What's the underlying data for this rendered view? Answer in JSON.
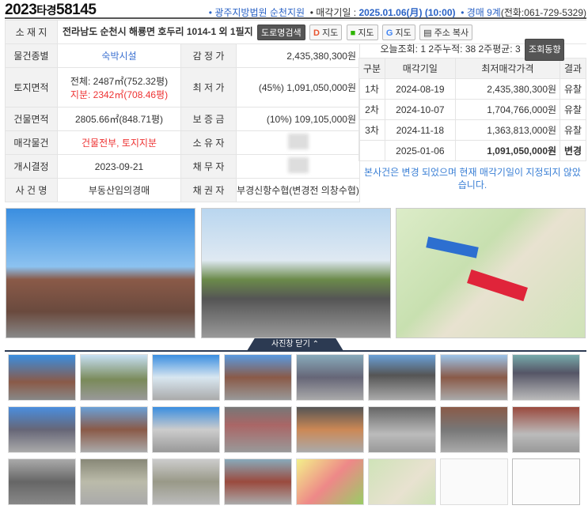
{
  "header": {
    "case_year": "2023",
    "case_type": "타경",
    "case_no": "58145",
    "court": "• 광주지방법원 순천지원",
    "sale_label": "• 매각기일 : ",
    "sale_date": "2025.01.06(月) (10:00)",
    "dept": "• 경매 9계",
    "phone": "(전화:061-729-5329)"
  },
  "address": {
    "label": "소 재 지",
    "value": "전라남도 순천시 해룡면 호두리 1014-1 외 1필지",
    "buttons": [
      "도로명검색",
      "지도",
      "지도",
      "지도",
      "주소 복사"
    ]
  },
  "rows": [
    {
      "l1": "물건종별",
      "v1": "숙박시설",
      "l2": "감 정 가",
      "v2": "2,435,380,300원"
    },
    {
      "l1": "토지면적",
      "v1a": "전체: 2487㎡(752.32평)",
      "v1b": "지분: 2342㎡(708.46평)",
      "l2": "최 저 가",
      "v2": "(45%) 1,091,050,000원"
    },
    {
      "l1": "건물면적",
      "v1": "2805.66㎡(848.71평)",
      "l2": "보 증 금",
      "v2": "(10%) 109,105,000원"
    },
    {
      "l1": "매각물건",
      "v1": "건물전부, 토지지분",
      "l2": "소 유 자",
      "v2": ""
    },
    {
      "l1": "개시결정",
      "v1": "2023-09-21",
      "l2": "채 무 자",
      "v2": ""
    },
    {
      "l1": "사 건 명",
      "v1": "부동산임의경매",
      "l2": "채 권 자",
      "v2": "부경신항수협(변경전 의창수협)"
    }
  ],
  "stats": {
    "text": "오늘조회: 1  2주누적: 38  2주평균: 3",
    "button": "조회동향"
  },
  "history": {
    "headers": [
      "구분",
      "매각기일",
      "최저매각가격",
      "결과"
    ],
    "rows": [
      [
        "1차",
        "2024-08-19",
        "2,435,380,300원",
        "유찰"
      ],
      [
        "2차",
        "2024-10-07",
        "1,704,766,000원",
        "유찰"
      ],
      [
        "3차",
        "2024-11-18",
        "1,363,813,000원",
        "유찰"
      ],
      [
        "",
        "2025-01-06",
        "1,091,050,000원",
        "변경"
      ]
    ]
  },
  "notice": "본사건은 변경 되었으며 현재 매각기일이 지정되지 않았습니다.",
  "photos": {
    "close_label": "사진창 닫기 ⌃"
  }
}
